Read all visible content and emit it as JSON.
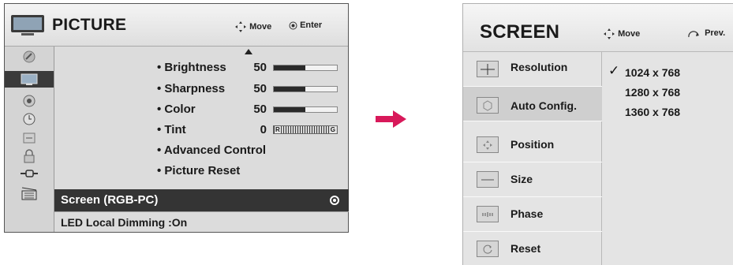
{
  "picture_menu": {
    "title": "PICTURE",
    "hint_move": "Move",
    "hint_enter": "Enter",
    "items": [
      {
        "label": "• Brightness",
        "value": "50",
        "level": 0.5
      },
      {
        "label": "• Sharpness",
        "value": "50",
        "level": 0.5
      },
      {
        "label": "• Color",
        "value": "50",
        "level": 0.5
      },
      {
        "label": "• Tint",
        "value": "0",
        "tint_left": "R",
        "tint_right": "G"
      },
      {
        "label": "• Advanced Control"
      },
      {
        "label": "• Picture Reset"
      }
    ],
    "selected_item": "Screen (RGB-PC)",
    "led_item": "LED Local Dimming :On",
    "sidebar_icons": [
      "wrench-icon",
      "picture-icon",
      "audio-icon",
      "clock-icon",
      "option-icon",
      "lock-icon",
      "input-icon",
      "movie-icon"
    ],
    "active_sidebar_index": 1
  },
  "screen_menu": {
    "title": "SCREEN",
    "hint_move": "Move",
    "hint_prev": "Prev.",
    "items": [
      {
        "label": "Resolution",
        "icon": "resolution-icon"
      },
      {
        "label": "Auto Config.",
        "icon": "auto-config-icon"
      },
      {
        "label": "Position",
        "icon": "position-icon"
      },
      {
        "label": "Size",
        "icon": "size-icon"
      },
      {
        "label": "Phase",
        "icon": "phase-icon"
      },
      {
        "label": "Reset",
        "icon": "reset-icon"
      }
    ],
    "resolution_options": [
      "1024 x 768",
      "1280 x 768",
      "1360 x 768"
    ],
    "checked_option_index": 0
  },
  "colors": {
    "selected_row": "#343434",
    "bar_fill": "#2a2a2a",
    "arrow": "#d8195a"
  }
}
